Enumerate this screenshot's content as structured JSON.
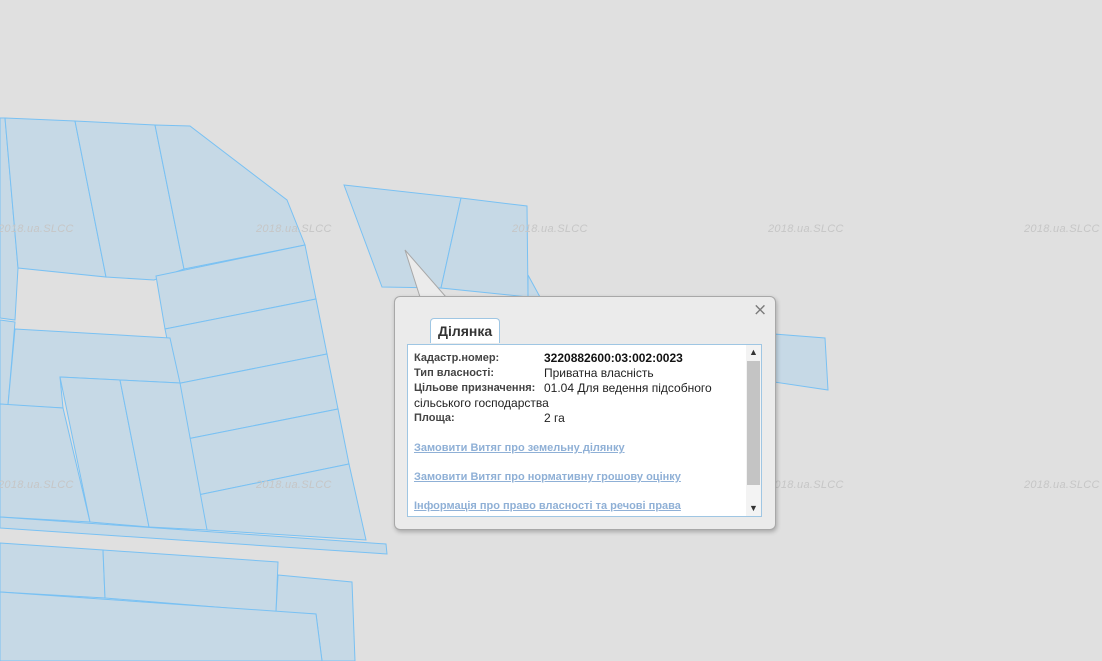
{
  "watermark": "2018.ua.SLCC",
  "map": {
    "parcel_fill": "#c6d9e6",
    "parcel_stroke": "#79c1f3",
    "background": "#e0e0e0"
  },
  "popup": {
    "tab_label": "Ділянка",
    "close_symbol": "×",
    "fields": [
      {
        "label": "Кадастр.номер:",
        "value": "3220882600:03:002:0023"
      },
      {
        "label": "Тип власності:",
        "value": "Приватна власність"
      },
      {
        "label": "Цільове призначення:",
        "value": "01.04 Для ведення підсобного сільського господарства"
      },
      {
        "label": "Площа:",
        "value": "2 га"
      }
    ],
    "links": [
      "Замовити Витяг про земельну ділянку",
      "Замовити Витяг про нормативну грошову оцінку",
      "Інформація про право власності та речові права"
    ]
  }
}
